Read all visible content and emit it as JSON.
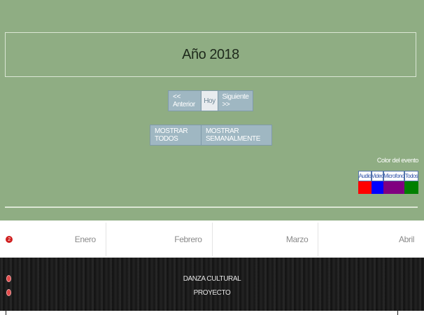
{
  "header": {
    "title": "Año 2018"
  },
  "navigation": {
    "prev_label": "<< Anterior",
    "today_label": "Hoy",
    "next_label": "Siguiente >>"
  },
  "view_toggle": {
    "show_all_label": "MOSTRAR TODOS",
    "show_weekly_label": "MOSTRAR SEMANALMENTE"
  },
  "color_legend": {
    "title": "Color del evento",
    "items": [
      {
        "label": "Audio",
        "color": "#ff0000"
      },
      {
        "label": "Video",
        "color": "#0000ff"
      },
      {
        "label": "Microfono",
        "color": "#800080"
      },
      {
        "label": "Todos",
        "color": "#008000"
      }
    ]
  },
  "months": {
    "badge": "2",
    "labels": [
      "Enero",
      "Febrero",
      "Marzo",
      "Abril"
    ]
  },
  "events": [
    {
      "title": "DANZA CULTURAL"
    },
    {
      "title": "PROYECTO"
    }
  ],
  "colors": {
    "page_background": "#8fad83",
    "button_background": "#9fb7c2",
    "event_badge": "#d01f1f"
  }
}
